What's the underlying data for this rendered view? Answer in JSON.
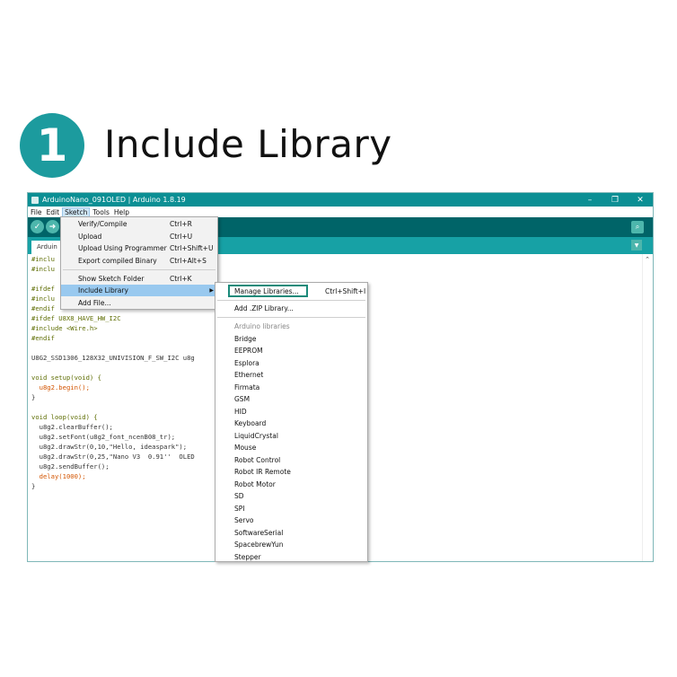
{
  "header": {
    "step_number": "1",
    "title": "Include Library"
  },
  "window": {
    "title": "ArduinoNano_091OLED | Arduino 1.8.19",
    "controls": {
      "minimize": "–",
      "maximize": "❐",
      "close": "✕"
    }
  },
  "menubar": {
    "items": [
      "File",
      "Edit",
      "Sketch",
      "Tools",
      "Help"
    ]
  },
  "tab": {
    "label": "Arduin"
  },
  "sketch_menu": {
    "items": [
      {
        "label": "Verify/Compile",
        "shortcut": "Ctrl+R"
      },
      {
        "label": "Upload",
        "shortcut": "Ctrl+U"
      },
      {
        "label": "Upload Using Programmer",
        "shortcut": "Ctrl+Shift+U"
      },
      {
        "label": "Export compiled Binary",
        "shortcut": "Ctrl+Alt+S"
      },
      {
        "label": "Show Sketch Folder",
        "shortcut": "Ctrl+K"
      },
      {
        "label": "Include Library",
        "shortcut": ""
      },
      {
        "label": "Add File...",
        "shortcut": ""
      }
    ]
  },
  "library_menu": {
    "manage": {
      "label": "Manage Libraries...",
      "shortcut": "Ctrl+Shift+I"
    },
    "add_zip": "Add .ZIP Library...",
    "section_label": "Arduino libraries",
    "libraries": [
      "Bridge",
      "EEPROM",
      "Esplora",
      "Ethernet",
      "Firmata",
      "GSM",
      "HID",
      "Keyboard",
      "LiquidCrystal",
      "Mouse",
      "Robot Control",
      "Robot IR Remote",
      "Robot Motor",
      "SD",
      "SPI",
      "Servo",
      "SoftwareSerial",
      "SpacebrewYun",
      "Stepper"
    ]
  },
  "code": {
    "lines": [
      "#inclu",
      "#inclu",
      "",
      "#ifdef",
      "#inclu",
      "#endif",
      "#ifdef U8X8_HAVE_HW_I2C",
      "#include <Wire.h>",
      "#endif",
      "",
      "U8G2_SSD1306_128X32_UNIVISION_F_SW_I2C u8g",
      "",
      "void setup(void) {",
      "  u8g2.begin();",
      "}",
      "",
      "void loop(void) {",
      "  u8g2.clearBuffer();",
      "  u8g2.setFont(u8g2_font_ncenB08_tr);",
      "  u8g2.drawStr(0,10,\"Hello, ideaspark\");",
      "  u8g2.drawStr(0,25,\"Nano V3  0.91''  OLED",
      "  u8g2.sendBuffer();",
      "  delay(1000);",
      "}"
    ]
  }
}
